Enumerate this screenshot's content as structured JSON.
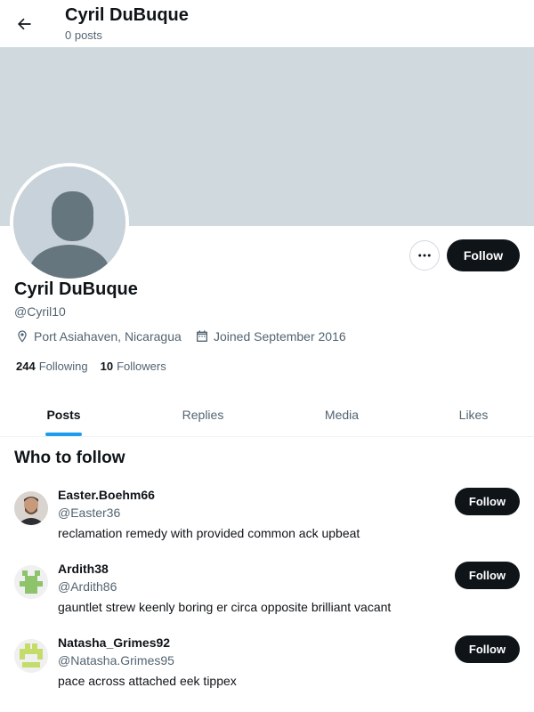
{
  "header": {
    "title": "Cyril DuBuque",
    "subtitle": "0 posts"
  },
  "profile": {
    "name": "Cyril DuBuque",
    "handle": "@Cyril10",
    "location": "Port Asiahaven, Nicaragua",
    "joined": "Joined September 2016",
    "following_count": "244",
    "following_label": "Following",
    "followers_count": "10",
    "followers_label": "Followers",
    "follow_label": "Follow",
    "banner_color": "#cfd9de"
  },
  "tabs": [
    {
      "label": "Posts",
      "active": true
    },
    {
      "label": "Replies",
      "active": false
    },
    {
      "label": "Media",
      "active": false
    },
    {
      "label": "Likes",
      "active": false
    }
  ],
  "who_to_follow": {
    "title": "Who to follow",
    "users": [
      {
        "name": "Easter.Boehm66",
        "handle": "@Easter36",
        "bio": "reclamation remedy with provided common ack upbeat",
        "follow_label": "Follow",
        "avatar": "photo"
      },
      {
        "name": "Ardith38",
        "handle": "@Ardith86",
        "bio": "gauntlet strew keenly boring er circa opposite brilliant vacant",
        "follow_label": "Follow",
        "avatar": "identicon-green"
      },
      {
        "name": "Natasha_Grimes92",
        "handle": "@Natasha.Grimes95",
        "bio": "pace across attached eek tippex",
        "follow_label": "Follow",
        "avatar": "identicon-lime"
      }
    ]
  },
  "colors": {
    "accent": "#1d9bf0",
    "text": "#0f1419",
    "secondary": "#536471"
  }
}
